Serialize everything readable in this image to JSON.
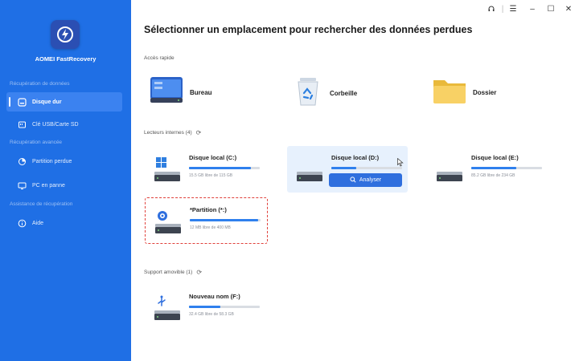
{
  "app": {
    "name": "AOMEI FastRecovery"
  },
  "sidebar": {
    "sections": [
      {
        "label": "Récupération de données"
      },
      {
        "label": "Récupération avancée"
      },
      {
        "label": "Assistance de récupération"
      }
    ],
    "items": [
      {
        "label": "Disque dur",
        "icon": "hard-drive-icon",
        "active": true
      },
      {
        "label": "Clé USB/Carte SD",
        "icon": "usb-card-icon"
      },
      {
        "label": "Partition perdue",
        "icon": "lost-partition-icon"
      },
      {
        "label": "PC en panne",
        "icon": "crashed-pc-icon"
      },
      {
        "label": "Aide",
        "icon": "help-icon"
      }
    ]
  },
  "window_controls": {
    "support": "headset-icon",
    "menu": "menu-icon",
    "minimize": "minimize-icon",
    "maximize": "maximize-icon",
    "close": "close-icon"
  },
  "main": {
    "title": "Sélectionner un emplacement pour rechercher des données perdues",
    "quick_access": {
      "label": "Accès rapide",
      "items": [
        {
          "label": "Bureau",
          "icon": "desktop-icon"
        },
        {
          "label": "Corbeille",
          "icon": "recycle-bin-icon"
        },
        {
          "label": "Dossier",
          "icon": "folder-icon"
        }
      ]
    },
    "internal_drives": {
      "label": "Lecteurs internes (4)",
      "drives": [
        {
          "name": "Disque local (C:)",
          "size": "15.5 GB libre de 115 GB",
          "used_fraction": 0.88,
          "icon": "windows-drive-icon"
        },
        {
          "name": "Disque local (D:)",
          "used_fraction": 0.35,
          "icon": "drive-icon",
          "hovered": true,
          "scan_label": "Analyser"
        },
        {
          "name": "Disque local (E:)",
          "size": "85.2 GB libre de 234 GB",
          "used_fraction": 0.64,
          "icon": "drive-icon"
        },
        {
          "name": "*Partition (*:)",
          "size": "12 MB libre de 400 MB",
          "used_fraction": 0.97,
          "icon": "partition-drive-icon",
          "selected": true
        }
      ]
    },
    "removable": {
      "label": "Support amovible (1)",
      "drives": [
        {
          "name": "Nouveau nom (F:)",
          "size": "32.4 GB libre de 58.3 GB",
          "used_fraction": 0.44,
          "icon": "usb-drive-icon"
        }
      ]
    }
  },
  "colors": {
    "sidebar": "#1f6fe5",
    "accent": "#2f6fde",
    "selected_border": "#e0403a"
  }
}
